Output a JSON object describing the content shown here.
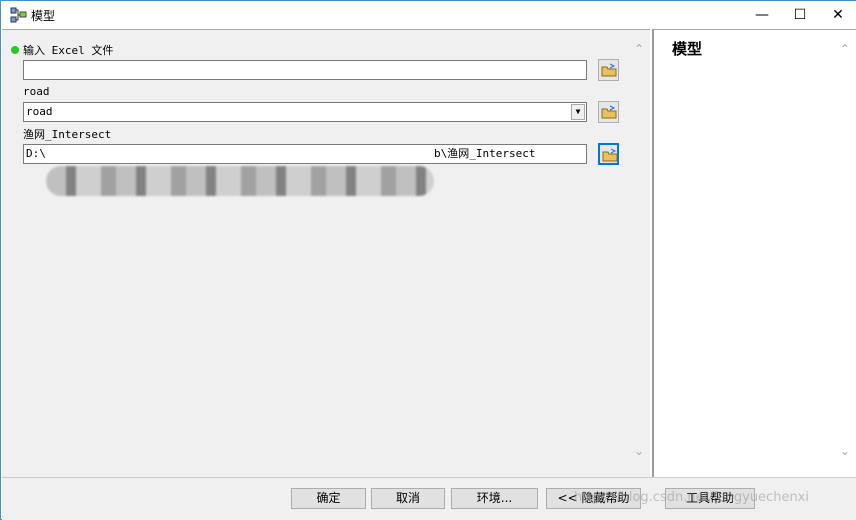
{
  "window": {
    "title": "模型",
    "icon": "model-icon"
  },
  "params": [
    {
      "label": "输入 Excel 文件",
      "value": "",
      "required": true
    },
    {
      "label": "road",
      "value": "road",
      "type": "dropdown"
    },
    {
      "label": "渔网_Intersect",
      "value_prefix": "D:\\",
      "value_suffix": "b\\渔网_Intersect"
    }
  ],
  "help": {
    "title": "模型"
  },
  "buttons": {
    "ok": "确定",
    "cancel": "取消",
    "env": "环境...",
    "hide_help": "<< 隐藏帮助",
    "tool_help": "工具帮助"
  },
  "watermark": "https://blog.csdn.net/fengyuechenxi",
  "colors": {
    "required_dot": "#22cc22",
    "focus": "#0078d7"
  }
}
